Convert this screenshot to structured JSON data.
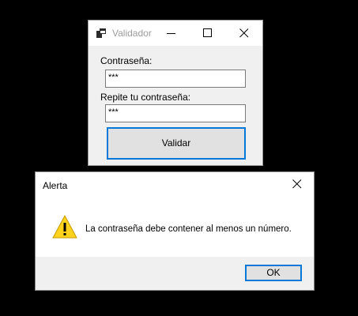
{
  "validator_window": {
    "title": "Validador",
    "icon": "app-window-icon",
    "controls": [
      "minimize-icon",
      "maximize-icon",
      "close-icon"
    ],
    "password_label": "Contraseña:",
    "password_value": "***",
    "repeat_label": "Repite tu contraseña:",
    "repeat_value": "***",
    "validate_button": "Validar"
  },
  "alert_dialog": {
    "title": "Alerta",
    "icon": "warning-icon",
    "message": "La contraseña debe contener al menos un número.",
    "ok_button": "OK"
  },
  "colors": {
    "accent": "#0078d7",
    "window_background": "#f0f0f0",
    "desktop_background": "#000000",
    "warning": "#ffd21e"
  }
}
